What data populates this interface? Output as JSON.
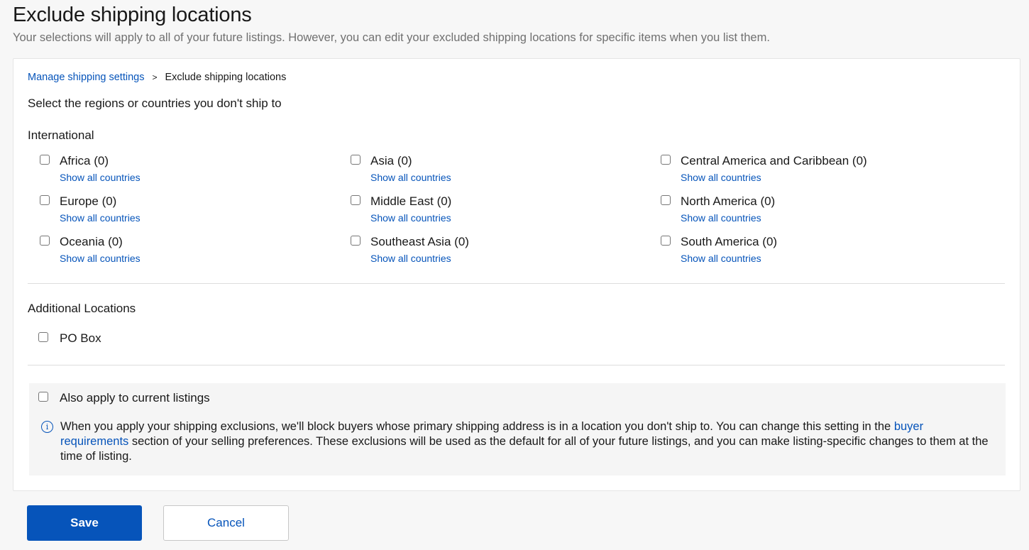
{
  "header": {
    "title": "Exclude shipping locations",
    "subtitle": "Your selections will apply to all of your future listings. However, you can edit your excluded shipping locations for specific items when you list them."
  },
  "breadcrumb": {
    "parent": "Manage shipping settings",
    "separator": ">",
    "current": "Exclude shipping locations"
  },
  "instructions": "Select the regions or countries you don't ship to",
  "international": {
    "heading": "International",
    "link_label": "Show all countries",
    "regions": [
      {
        "label": "Africa",
        "count": "(0)",
        "checked": false
      },
      {
        "label": "Asia",
        "count": "(0)",
        "checked": false
      },
      {
        "label": "Central America and Caribbean",
        "count": "(0)",
        "checked": false
      },
      {
        "label": "Europe",
        "count": "(0)",
        "checked": false
      },
      {
        "label": "Middle East",
        "count": "(0)",
        "checked": false
      },
      {
        "label": "North America",
        "count": "(0)",
        "checked": false
      },
      {
        "label": "Oceania",
        "count": "(0)",
        "checked": false
      },
      {
        "label": "Southeast Asia",
        "count": "(0)",
        "checked": false
      },
      {
        "label": "South America",
        "count": "(0)",
        "checked": false
      }
    ]
  },
  "additional": {
    "heading": "Additional Locations",
    "items": [
      {
        "label": "PO Box",
        "checked": false
      }
    ]
  },
  "apply_current": {
    "label": "Also apply to current listings",
    "checked": false,
    "info_icon": "info-icon",
    "info_before": "When you apply your shipping exclusions, we'll block buyers whose primary shipping address is in a location you don't ship to. You can change this setting in the ",
    "info_link": "buyer requirements",
    "info_after": " section of your selling preferences. These exclusions will be used as the default for all of your future listings, and you can make listing-specific changes to them at the time of listing."
  },
  "actions": {
    "save_label": "Save",
    "cancel_label": "Cancel"
  },
  "colors": {
    "primary": "#0654ba",
    "text": "#191919",
    "muted": "#707070",
    "background": "#f7f7f7"
  }
}
